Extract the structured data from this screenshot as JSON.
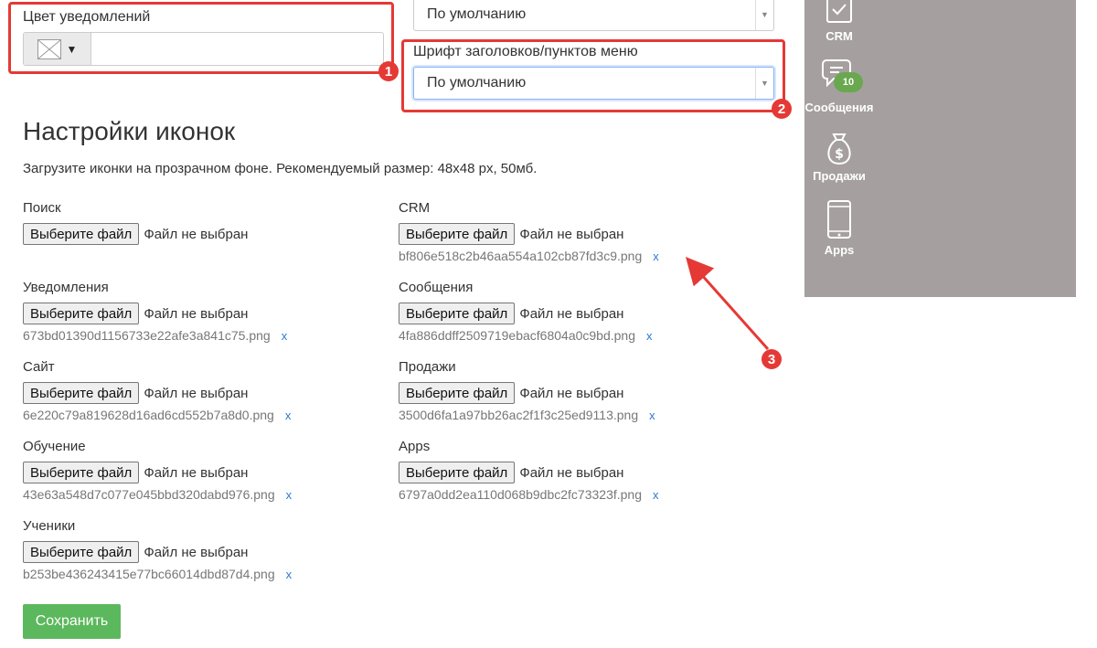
{
  "notification_color": {
    "label": "Цвет уведомлений",
    "value": ""
  },
  "top_select": {
    "value": "По умолчанию"
  },
  "heading_font": {
    "label": "Шрифт заголовков/пунктов меню",
    "value": "По умолчанию"
  },
  "icons_section": {
    "title": "Настройки иконок",
    "description": "Загрузите иконки на прозрачном фоне. Рекомендуемый размер: 48x48 px, 50мб.",
    "choose_file_label": "Выберите файл",
    "no_file_text": "Файл не выбран",
    "remove_symbol": "x",
    "fields": [
      {
        "label": "Поиск",
        "filename": ""
      },
      {
        "label": "CRM",
        "filename": "bf806e518c2b46aa554a102cb87fd3c9.png"
      },
      {
        "label": "Уведомления",
        "filename": "673bd01390d1156733e22afe3a841c75.png"
      },
      {
        "label": "Сообщения",
        "filename": "4fa886ddff2509719ebacf6804a0c9bd.png"
      },
      {
        "label": "Сайт",
        "filename": "6e220c79a819628d16ad6cd552b7a8d0.png"
      },
      {
        "label": "Продажи",
        "filename": "3500d6fa1a97bb26ac2f1f3c25ed9113.png"
      },
      {
        "label": "Обучение",
        "filename": "43e63a548d7c077e045bbd320dabd976.png"
      },
      {
        "label": "Apps",
        "filename": "6797a0dd2ea110d068b9dbc2fc73323f.png"
      },
      {
        "label": "Ученики",
        "filename": "b253be436243415e77bc66014dbd87d4.png"
      }
    ]
  },
  "save_button": "Сохранить",
  "sidebar_preview": {
    "items": [
      {
        "label": "CRM",
        "icon": "crm-icon"
      },
      {
        "label": "Сообщения",
        "icon": "chat-bubble-icon",
        "badge": "10"
      },
      {
        "label": "Продажи",
        "icon": "money-bag-icon"
      },
      {
        "label": "Apps",
        "icon": "tablet-icon"
      }
    ]
  },
  "annotations": [
    "1",
    "2",
    "3"
  ],
  "colors": {
    "annotation": "#e53935",
    "save": "#5cb85c",
    "sidebar": "#a5a09f",
    "link": "#2a7ad4",
    "badge": "#6aa84f"
  }
}
